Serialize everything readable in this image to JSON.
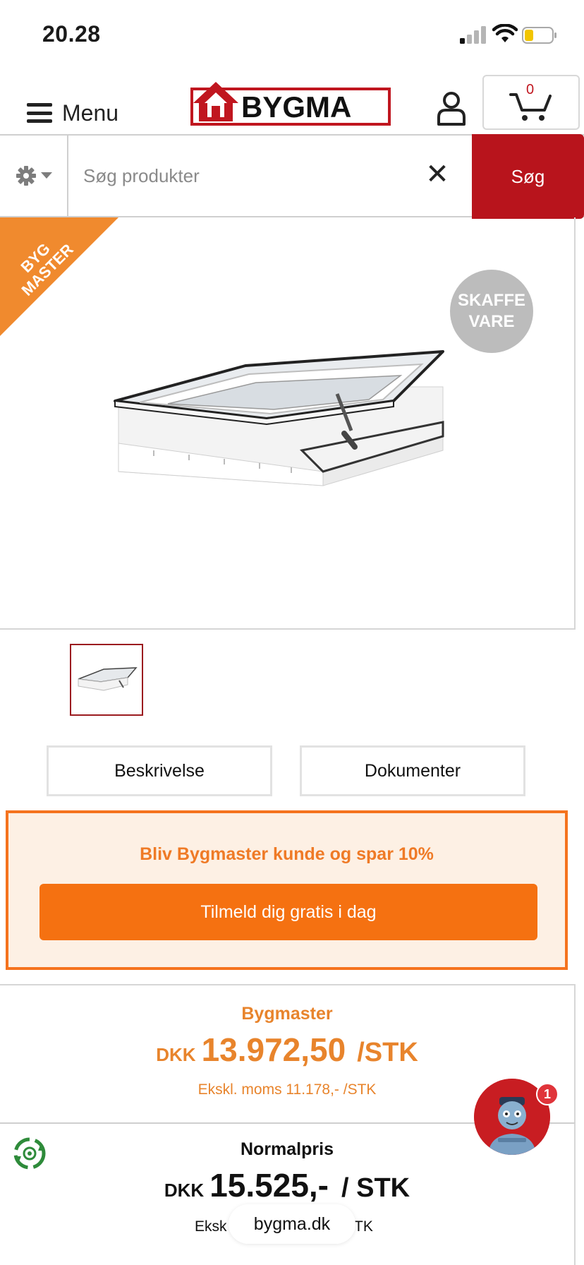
{
  "status_bar": {
    "time": "20.28"
  },
  "header": {
    "menu_label": "Menu",
    "logo_text": "BYGMA",
    "cart_count": "0"
  },
  "search": {
    "placeholder": "Søg produkter",
    "clear_label": "✕",
    "button_label": "Søg"
  },
  "product": {
    "ribbon_text": "BYG MASTER",
    "stock_badge_line1": "SKAFFE",
    "stock_badge_line2": "VARE"
  },
  "tabs": [
    {
      "label": "Beskrivelse"
    },
    {
      "label": "Dokumenter"
    }
  ],
  "promo": {
    "text": "Bliv Bygmaster kunde og spar 10%",
    "button_label": "Tilmeld dig gratis i dag"
  },
  "bygmaster_price": {
    "label": "Bygmaster",
    "currency": "DKK",
    "amount": "13.972,50",
    "unit": "/STK",
    "ex_vat": "Ekskl. moms 11.178,- /STK"
  },
  "normal_price": {
    "label": "Normalpris",
    "currency": "DKK",
    "amount": "15.525,-",
    "unit": "/ STK",
    "ex_vat_prefix": "Eksk",
    "ex_vat_suffix": "TK"
  },
  "browser": {
    "url": "bygma.dk"
  },
  "chat": {
    "badge_count": "1"
  },
  "colors": {
    "brand_red": "#b8141c",
    "bygmaster_orange": "#f57111",
    "promo_bg": "#fdf0e4"
  },
  "icons": [
    "signal-icon",
    "wifi-icon",
    "battery-icon",
    "hamburger-icon",
    "user-icon",
    "cart-icon",
    "gear-icon",
    "close-icon",
    "recycle-icon",
    "chat-avatar-icon"
  ]
}
